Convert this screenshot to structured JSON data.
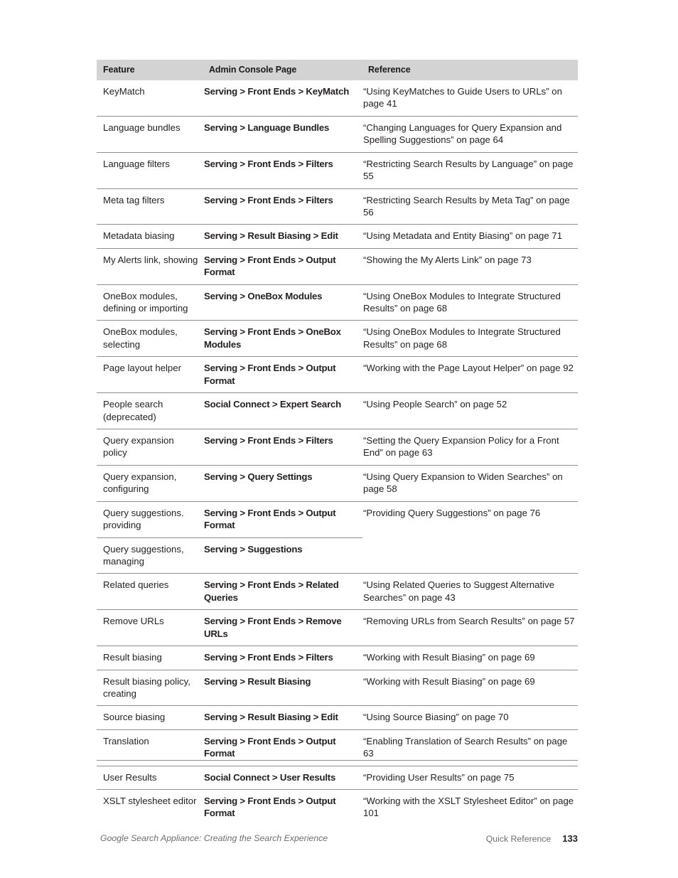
{
  "document": {
    "title": "Google Search Appliance: Creating the Search Experience",
    "section": "Quick Reference",
    "page_number": "133"
  },
  "table": {
    "name": "quick-reference-table",
    "headers": {
      "feature": "Feature",
      "console": "Admin Console Page",
      "reference": "Reference"
    },
    "rows": [
      {
        "feature": "KeyMatch",
        "console": "Serving > Front Ends > KeyMatch",
        "reference": "“Using KeyMatches to Guide Users to URLs” on page 41"
      },
      {
        "feature": "Language bundles",
        "console": "Serving > Language Bundles",
        "reference": "“Changing Languages for Query Expansion and Spelling Suggestions” on page 64"
      },
      {
        "feature": "Language filters",
        "console": "Serving > Front Ends > Filters",
        "reference": "“Restricting Search Results by Language” on page 55"
      },
      {
        "feature": "Meta tag filters",
        "console": "Serving > Front Ends > Filters",
        "reference": "“Restricting Search Results by Meta Tag” on page 56"
      },
      {
        "feature": "Metadata biasing",
        "console": "Serving > Result Biasing > Edit",
        "reference": "“Using Metadata and Entity Biasing” on page 71"
      },
      {
        "feature": "My Alerts link, showing",
        "console": "Serving > Front Ends > Output Format",
        "reference": "“Showing the My Alerts Link” on page 73"
      },
      {
        "feature": "OneBox modules, defining or importing",
        "console": "Serving > OneBox Modules",
        "reference": "“Using OneBox Modules to Integrate Structured Results” on page 68"
      },
      {
        "feature": "OneBox modules, selecting",
        "console": "Serving > Front Ends > OneBox Modules",
        "reference": "“Using OneBox Modules to Integrate Structured Results” on page 68"
      },
      {
        "feature": "Page layout helper",
        "console": "Serving > Front Ends > Output Format",
        "reference": "“Working with the Page Layout Helper” on page 92"
      },
      {
        "feature": "People search (deprecated)",
        "console": "Social Connect > Expert Search",
        "reference": "“Using People Search” on page 52"
      },
      {
        "feature": "Query expansion policy",
        "console": "Serving > Front Ends > Filters",
        "reference": "“Setting the Query Expansion Policy for a Front End” on page 63"
      },
      {
        "feature": "Query expansion, configuring",
        "console": "Serving > Query Settings",
        "reference": "“Using Query Expansion to Widen Searches” on page 58"
      },
      {
        "feature": "Query suggestions. providing",
        "console": "Serving > Front Ends > Output Format",
        "reference": "“Providing Query Suggestions” on page 76",
        "reference_rowspan": 2
      },
      {
        "feature": "Query suggestions, managing",
        "console": "Serving > Suggestions",
        "reference": "",
        "split_row": true
      },
      {
        "feature": "Related queries",
        "console": "Serving > Front Ends > Related Queries",
        "reference": "“Using Related Queries to Suggest Alternative Searches” on page 43"
      },
      {
        "feature": "Remove URLs",
        "console": "Serving > Front Ends > Remove URLs",
        "reference": "“Removing URLs from Search Results” on page 57"
      },
      {
        "feature": "Result biasing",
        "console": "Serving > Front Ends > Filters",
        "reference": "“Working with Result Biasing” on page 69"
      },
      {
        "feature": "Result biasing policy, creating",
        "console": "Serving > Result Biasing",
        "reference": "“Working with Result Biasing” on page 69"
      },
      {
        "feature": "Source biasing",
        "console": "Serving > Result Biasing > Edit",
        "reference": "“Using Source Biasing” on page 70"
      },
      {
        "feature": "Translation",
        "console": "Serving > Front Ends > Output Format",
        "reference": "“Enabling Translation of Search Results” on page 63"
      },
      {
        "feature": "User Results",
        "console": "Social Connect > User Results",
        "reference": "“Providing User Results” on page 75"
      },
      {
        "feature": "XSLT stylesheet editor",
        "console": "Serving > Front Ends > Output Format",
        "reference": "“Working with the XSLT Stylesheet Editor” on page 101"
      }
    ]
  },
  "colors": {
    "header_background": "#d3d3d3",
    "rule": "#8e8e8e",
    "text": "#231f20",
    "footer_text": "#6d6e71"
  }
}
